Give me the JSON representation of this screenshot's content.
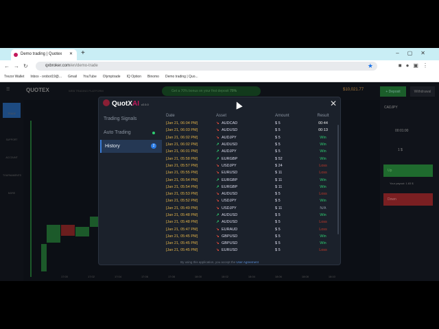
{
  "browser": {
    "tab_title": "Demo trading | Quotex",
    "url_host": "qxbroker.com",
    "url_path": "/en/demo-trade",
    "bookmarks": [
      "Trezor Wallet",
      "Inbox - orobot19@...",
      "Gmail",
      "YouTube",
      "Olymptrade",
      "IQ Option",
      "Binomo",
      "Demo trading | Quo..."
    ]
  },
  "quotex": {
    "logo": "QUOTEX",
    "subtitle": "WEB TRADING PLATFORM",
    "promo": "Get a 70% bonus on your first deposit",
    "promo_pct": "70%",
    "balance": "$10,021.77",
    "deposit": "+ Deposit",
    "withdraw": "Withdrawal",
    "sidebar": [
      "TRADE",
      "SUPPORT",
      "ACCOUNT",
      "TOURNAMENTS",
      "MORE"
    ],
    "asset": "CADJPY",
    "time": "00:01:00",
    "amount": "1 $",
    "up": "Up",
    "down": "Down",
    "payout": "Your payout: 1.83 $",
    "time_axis": [
      "17:00",
      "17:02",
      "17:04",
      "17:06",
      "17:08",
      "18:00",
      "18:02",
      "18:04",
      "18:06",
      "18:08",
      "18:10"
    ]
  },
  "modal": {
    "brand": "QuotX",
    "brand_ai": "AI",
    "version": "v2.0.0",
    "nav": [
      {
        "label": "Trading Signals"
      },
      {
        "label": "Auto Trading",
        "status": "active"
      },
      {
        "label": "History",
        "badge": "2"
      }
    ],
    "columns": [
      "Date",
      "Asset",
      "Amount",
      "Result"
    ],
    "rows": [
      {
        "date": "[Jan 21, 06:04 PM]",
        "dir": "down",
        "asset": "AUDCAD",
        "amount": "$ 5",
        "result": "00:44",
        "type": "timer"
      },
      {
        "date": "[Jan 21, 06:03 PM]",
        "dir": "down",
        "asset": "AUDUSD",
        "amount": "$ 5",
        "result": "00:13",
        "type": "timer"
      },
      {
        "date": "[Jan 21, 06:02 PM]",
        "dir": "down",
        "asset": "AUDJPY",
        "amount": "$ 5",
        "result": "Win",
        "type": "win"
      },
      {
        "date": "[Jan 21, 06:02 PM]",
        "dir": "up",
        "asset": "AUDUSD",
        "amount": "$ 5",
        "result": "Win",
        "type": "win"
      },
      {
        "date": "[Jan 21, 06:01 PM]",
        "dir": "up",
        "asset": "AUDJPY",
        "amount": "$ 5",
        "result": "Win",
        "type": "win"
      },
      {
        "date": "[Jan 21, 05:58 PM]",
        "dir": "up",
        "asset": "EURGBP",
        "amount": "$ 52",
        "result": "Win",
        "type": "win"
      },
      {
        "date": "[Jan 21, 05:57 PM]",
        "dir": "down",
        "asset": "USDJPY",
        "amount": "$ 24",
        "result": "Loss",
        "type": "loss"
      },
      {
        "date": "[Jan 21, 05:55 PM]",
        "dir": "down",
        "asset": "EURUSD",
        "amount": "$ 11",
        "result": "Loss",
        "type": "loss"
      },
      {
        "date": "[Jan 21, 05:54 PM]",
        "dir": "up",
        "asset": "EURGBP",
        "amount": "$ 11",
        "result": "Win",
        "type": "win"
      },
      {
        "date": "[Jan 21, 05:54 PM]",
        "dir": "up",
        "asset": "EURGBP",
        "amount": "$ 11",
        "result": "Win",
        "type": "win"
      },
      {
        "date": "[Jan 21, 05:53 PM]",
        "dir": "down",
        "asset": "AUDUSD",
        "amount": "$ 5",
        "result": "Loss",
        "type": "loss"
      },
      {
        "date": "[Jan 21, 05:52 PM]",
        "dir": "down",
        "asset": "USDJPY",
        "amount": "$ 5",
        "result": "Win",
        "type": "win"
      },
      {
        "date": "[Jan 21, 05:49 PM]",
        "dir": "down",
        "asset": "USDJPY",
        "amount": "$ 11",
        "result": "N/A",
        "type": "na"
      },
      {
        "date": "[Jan 21, 05:48 PM]",
        "dir": "up",
        "asset": "AUDUSD",
        "amount": "$ 5",
        "result": "Win",
        "type": "win"
      },
      {
        "date": "[Jan 21, 05:48 PM]",
        "dir": "up",
        "asset": "AUDUSD",
        "amount": "$ 5",
        "result": "Loss",
        "type": "loss"
      },
      {
        "date": "[Jan 21, 05:47 PM]",
        "dir": "down",
        "asset": "EURAUD",
        "amount": "$ 5",
        "result": "Loss",
        "type": "loss"
      },
      {
        "date": "[Jan 21, 05:45 PM]",
        "dir": "down",
        "asset": "GBPUSD",
        "amount": "$ 5",
        "result": "Win",
        "type": "win"
      },
      {
        "date": "[Jan 21, 05:45 PM]",
        "dir": "down",
        "asset": "GBPUSD",
        "amount": "$ 5",
        "result": "Win",
        "type": "win"
      },
      {
        "date": "[Jan 21, 05:45 PM]",
        "dir": "down",
        "asset": "EURUSD",
        "amount": "$ 5",
        "result": "Loss",
        "type": "loss"
      }
    ],
    "footer_text": "By using this application, you accept the",
    "footer_link": "User Agreement"
  }
}
